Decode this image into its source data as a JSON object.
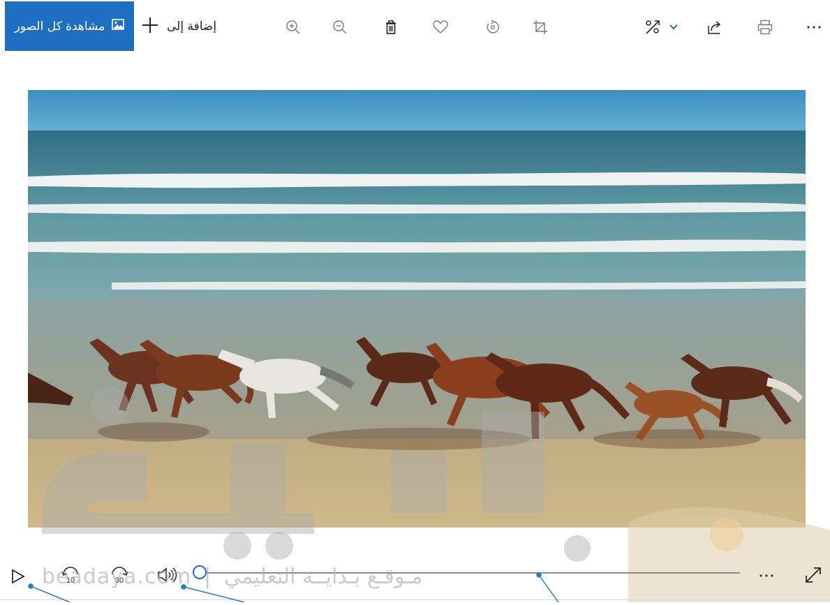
{
  "toolbar": {
    "see_all_label": "مشاهدة كل الصور",
    "add_to_label": "إضافة إلى",
    "icons": [
      "zoom-in-icon",
      "zoom-out-icon",
      "delete-icon",
      "favorite-icon",
      "rotate-icon",
      "crop-icon",
      "edit-create-icon",
      "chevron-down-icon",
      "share-icon",
      "print-icon",
      "more-icon"
    ]
  },
  "video": {
    "scene": "horses galloping along a beach with breaking waves",
    "playback_position": 0
  },
  "controls": {
    "skip_back_label": "10",
    "skip_forward_label": "30",
    "more_label": "···",
    "icons": [
      "play-icon",
      "skip-back-10-icon",
      "skip-forward-30-icon",
      "volume-icon",
      "seek-thumb",
      "more-icon",
      "fullscreen-icon"
    ]
  },
  "watermark": {
    "latin": "beadaya.com",
    "separator": "|",
    "arabic": "مـوقـع بـدايــة التعليمي"
  },
  "colors": {
    "accent": "#1e6fc1",
    "callout": "#2b7bc4",
    "sky": "#3f93c0",
    "sand": "#c9b38a"
  }
}
